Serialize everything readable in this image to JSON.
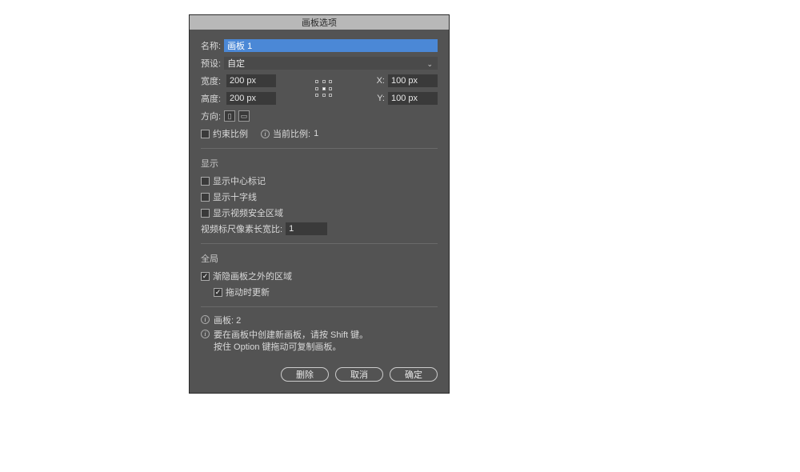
{
  "title": "画板选项",
  "name": {
    "label": "名称:",
    "value": "画板 1"
  },
  "preset": {
    "label": "预设:",
    "value": "自定"
  },
  "dims": {
    "widthLabel": "宽度:",
    "widthValue": "200 px",
    "heightLabel": "高度:",
    "heightValue": "200 px",
    "xLabel": "X:",
    "xValue": "100 px",
    "yLabel": "Y:",
    "yValue": "100 px"
  },
  "orientation": {
    "label": "方向:"
  },
  "constrain": {
    "label": "约束比例",
    "currentLabel": "当前比例:",
    "currentValue": "1"
  },
  "display": {
    "title": "显示",
    "center": "显示中心标记",
    "cross": "显示十字线",
    "safe": "显示视频安全区域",
    "pixelAspectLabel": "视频标尺像素长宽比:",
    "pixelAspectValue": "1"
  },
  "global": {
    "title": "全局",
    "fade": "渐隐画板之外的区域",
    "dragUpdate": "拖动时更新"
  },
  "info": {
    "countLabel": "画板:",
    "countValue": "2",
    "tip1": "要在画板中创建新画板，请按 Shift 键。",
    "tip2": "按住 Option 键拖动可复制画板。"
  },
  "buttons": {
    "delete": "删除",
    "cancel": "取消",
    "ok": "确定"
  }
}
